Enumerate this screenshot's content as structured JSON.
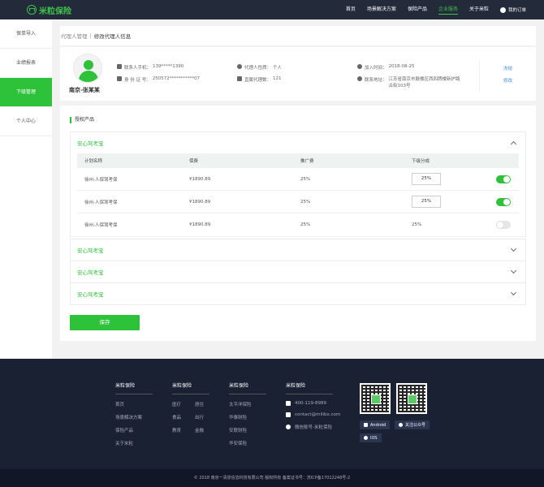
{
  "header": {
    "logo": "米粒保险",
    "nav": [
      "首页",
      "场景解决方案",
      "保险产品",
      "企业服务",
      "关于米粒"
    ],
    "active_nav": "企业服务",
    "orders": "我的订单"
  },
  "sidebar": {
    "items": [
      {
        "label": "保单导入",
        "active": false
      },
      {
        "label": "业绩报表",
        "active": false
      },
      {
        "label": "下级管理",
        "active": true
      },
      {
        "label": "个人中心",
        "active": false
      }
    ]
  },
  "breadcrumb": {
    "parent": "代理人管理",
    "separator": "|",
    "current": "修改代理人信息"
  },
  "profile": {
    "name": "南京-张某某",
    "phone_label": "联系人手机：",
    "phone": "139*****1390",
    "id_label": "身 份 证 号：",
    "id": "250572***********07",
    "type_label": "代理人性质：",
    "type": "个人",
    "subs_label": "直属代理数：",
    "subs": "121",
    "join_label": "加入时间：",
    "join": "2018-08-25",
    "address_label": "联系地址：",
    "address": "江苏省南京市鼓楼区西四牌楼新护路古街103号",
    "freeze": "冻结",
    "edit": "修改"
  },
  "products": {
    "title": "授权产品",
    "headers": [
      "计划名称",
      "保费",
      "推广费",
      "下级分成"
    ],
    "groups": [
      {
        "name": "安心驾考宝",
        "expanded": true,
        "rows": [
          {
            "plan": "徐州-人保驾考保",
            "premium": "¥1890.89",
            "promo": "25%",
            "share": "25%",
            "editable": true,
            "enabled": true
          },
          {
            "plan": "徐州-人保驾考保",
            "premium": "¥1890.89",
            "promo": "25%",
            "share": "25%",
            "editable": true,
            "enabled": true
          },
          {
            "plan": "徐州-人保驾考保",
            "premium": "¥1890.89",
            "promo": "25%",
            "share": "25%",
            "editable": false,
            "enabled": false
          }
        ]
      },
      {
        "name": "安心驾考宝",
        "expanded": false
      },
      {
        "name": "安心驾考宝",
        "expanded": false
      },
      {
        "name": "安心驾考宝",
        "expanded": false
      }
    ],
    "save": "保存"
  },
  "footer": {
    "col1": {
      "title": "米粒保险",
      "links": [
        "首页",
        "场景解决方案",
        "保险产品",
        "关于米粒"
      ]
    },
    "col2": {
      "title": "米粒保险",
      "links": [
        "医疗",
        "居住",
        "食品",
        "出行",
        "教育",
        "金融"
      ]
    },
    "col3": {
      "title": "米粒保险",
      "links": [
        "太平洋保险",
        "华泰财险",
        "安联财险",
        "华安保险"
      ]
    },
    "col4": {
      "title": "米粒保险",
      "phone": "400-119-8989",
      "email": "contact@milibx.com",
      "wechat": "微信账号-米粒保险"
    },
    "badges": [
      "Android",
      "关注公众号",
      "IOS"
    ],
    "copyright": "© 2018 南京一清泉信息科技有限公司 版权所有 备案证书号：苏ICP备17012248号-2"
  }
}
